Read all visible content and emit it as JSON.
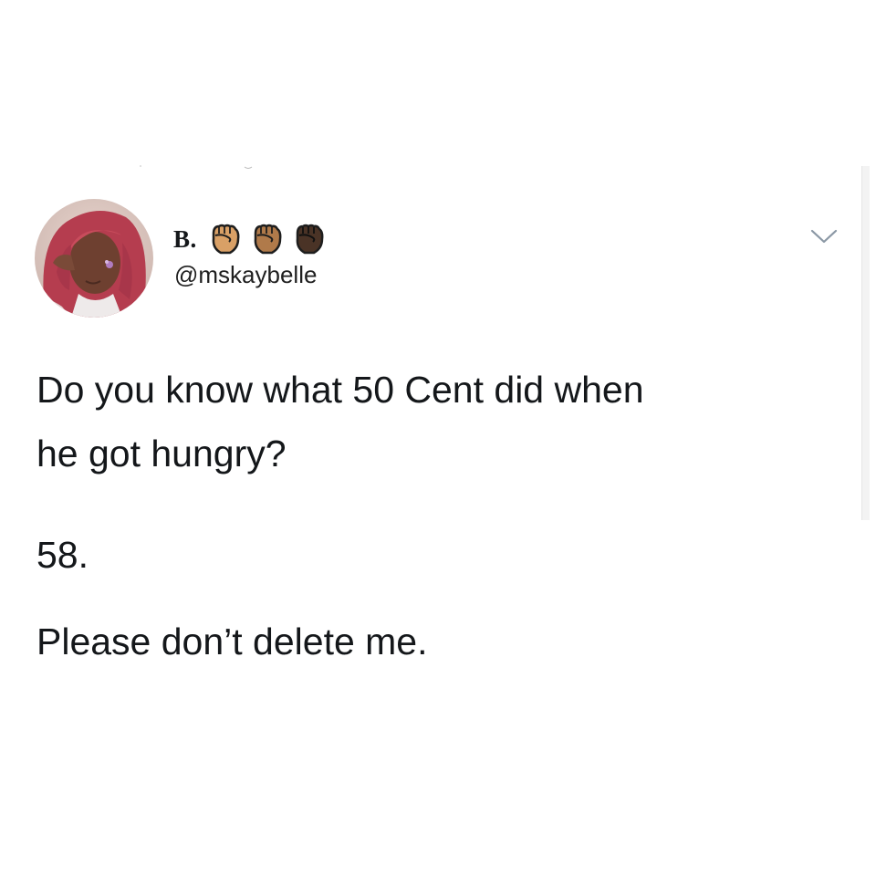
{
  "tweet": {
    "author": {
      "display_name": "B.",
      "handle": "@mskaybelle",
      "name_emojis": [
        "raised-fist-medium-light-skin",
        "raised-fist-medium-skin",
        "raised-fist-dark-skin"
      ],
      "avatar_icon": "profile-photo"
    },
    "body": {
      "line1": "Do you know what 50 Cent did when",
      "line2": "he got hungry?",
      "line3": "58.",
      "line4": "Please don’t delete me."
    },
    "menu_icon": "chevron-down-icon"
  },
  "colors": {
    "background": "#ffffff",
    "text": "#14171a",
    "chevron": "#8b98a5",
    "fist_light": "#d9a066",
    "fist_medium": "#b07a4a",
    "fist_dark": "#4a3326"
  }
}
